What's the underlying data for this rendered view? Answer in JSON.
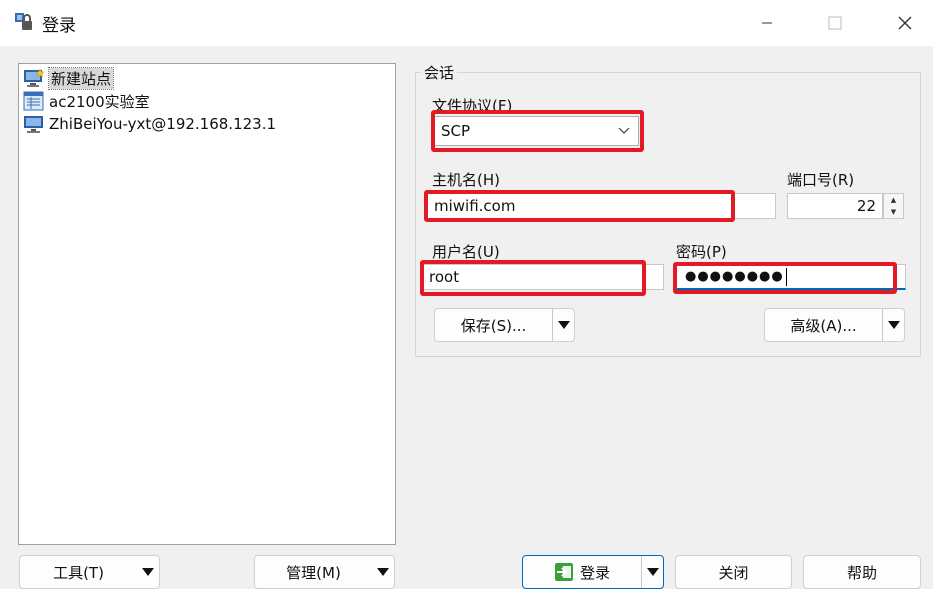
{
  "window": {
    "title": "登录",
    "icon": "winscp-lock-icon",
    "controls": {
      "minimize": "minimize-icon",
      "maximize": "maximize-icon",
      "close": "close-icon"
    }
  },
  "site_tree": {
    "items": [
      {
        "label": "新建站点",
        "icon": "new-site-monitor-icon",
        "selected": true
      },
      {
        "label": "ac2100实验室",
        "icon": "folder-list-icon",
        "selected": false
      },
      {
        "label": "ZhiBeiYou-yxt@192.168.123.1",
        "icon": "monitor-icon",
        "selected": false
      }
    ]
  },
  "session": {
    "group_label": "会话",
    "protocol_label": "文件协议(F)",
    "protocol_value": "SCP",
    "host_label": "主机名(H)",
    "host_value": "miwifi.com",
    "port_label": "端口号(R)",
    "port_value": "22",
    "user_label": "用户名(U)",
    "user_value": "root",
    "password_label": "密码(P)",
    "password_value": "●●●●●●●●",
    "save_label": "保存(S)...",
    "advanced_label": "高级(A)..."
  },
  "bottom": {
    "tools_label": "工具(T)",
    "manage_label": "管理(M)",
    "login_label": "登录",
    "close_label": "关闭",
    "help_label": "帮助"
  },
  "colors": {
    "highlight": "#e01b24",
    "focus": "#0067c0",
    "background": "#f0f0f0"
  }
}
